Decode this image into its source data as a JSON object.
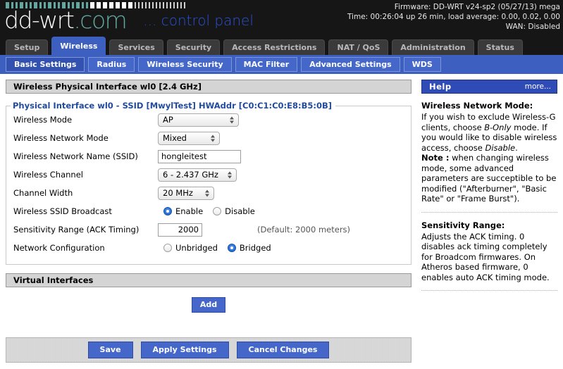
{
  "header": {
    "logo_main": "dd-wrt",
    "logo_tld": ".com",
    "logo_sub": "... control panel",
    "firmware_line": "Firmware: DD-WRT v24-sp2 (05/27/13) mega",
    "time_line": "Time: 00:26:04 up 26 min, load average: 0.00, 0.02, 0.00",
    "wan_line": "WAN: Disabled",
    "bg_color": "#161616",
    "accent_teal": "#64a6a0",
    "accent_blue": "#2a52d8"
  },
  "main_tabs": [
    {
      "label": "Setup",
      "active": false
    },
    {
      "label": "Wireless",
      "active": true
    },
    {
      "label": "Services",
      "active": false
    },
    {
      "label": "Security",
      "active": false
    },
    {
      "label": "Access Restrictions",
      "active": false
    },
    {
      "label": "NAT / QoS",
      "active": false
    },
    {
      "label": "Administration",
      "active": false
    },
    {
      "label": "Status",
      "active": false
    }
  ],
  "sub_tabs": [
    {
      "label": "Basic Settings",
      "active": true
    },
    {
      "label": "Radius",
      "active": false
    },
    {
      "label": "Wireless Security",
      "active": false
    },
    {
      "label": "MAC Filter",
      "active": false
    },
    {
      "label": "Advanced Settings",
      "active": false
    },
    {
      "label": "WDS",
      "active": false
    }
  ],
  "section": {
    "title": "Wireless Physical Interface wl0 [2.4 GHz]",
    "legend": "Physical Interface wl0 - SSID [MwylTest] HWAddr [C0:C1:C0:E8:B5:0B]"
  },
  "fields": {
    "wireless_mode": {
      "label": "Wireless Mode",
      "value": "AP"
    },
    "network_mode": {
      "label": "Wireless Network Mode",
      "value": "Mixed"
    },
    "ssid": {
      "label": "Wireless Network Name (SSID)",
      "value": "hongleitest",
      "placeholder": ""
    },
    "channel": {
      "label": "Wireless Channel",
      "value": "6 - 2.437 GHz"
    },
    "channel_width": {
      "label": "Channel Width",
      "value": "20 MHz"
    },
    "ssid_broadcast": {
      "label": "Wireless SSID Broadcast",
      "options": [
        "Enable",
        "Disable"
      ],
      "selected": "Enable"
    },
    "sensitivity": {
      "label": "Sensitivity Range (ACK Timing)",
      "value": "2000",
      "hint": "(Default: 2000 meters)"
    },
    "network_config": {
      "label": "Network Configuration",
      "options": [
        "Unbridged",
        "Bridged"
      ],
      "selected": "Bridged"
    }
  },
  "virtual_interfaces": {
    "title": "Virtual Interfaces",
    "add_label": "Add"
  },
  "actions": {
    "save": "Save",
    "apply": "Apply Settings",
    "cancel": "Cancel Changes"
  },
  "help": {
    "title": "Help",
    "more": "more...",
    "section1_title": "Wireless Network Mode:",
    "section1_p1_a": "If you wish to exclude Wireless-G clients, choose ",
    "section1_p1_i1": "B-Only",
    "section1_p1_b": " mode. If you would like to disable wireless access, choose ",
    "section1_p1_i2": "Disable",
    "section1_p1_c": ".",
    "section1_note_label": "Note :",
    "section1_note_text": " when changing wireless mode, some advanced parameters are succeptible to be modified (\"Afterburner\", \"Basic Rate\" or \"Frame Burst\").",
    "section2_title": "Sensitivity Range:",
    "section2_text": "Adjusts the ACK timing. 0 disables ack timing completely for Broadcom firmwares. On Atheros based firmware, 0 enables auto ACK timing mode."
  }
}
